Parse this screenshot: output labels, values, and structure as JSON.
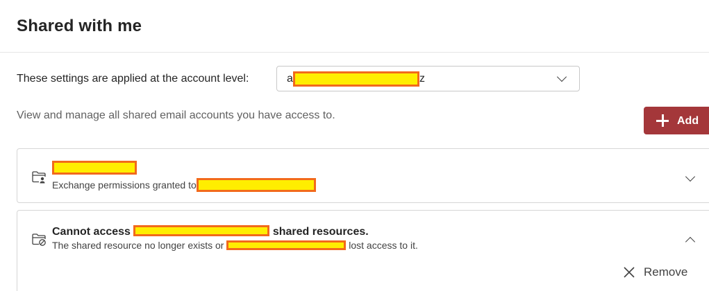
{
  "page": {
    "title": "Shared with me"
  },
  "account": {
    "label": "These settings are applied at the account level:",
    "selected_prefix": "a",
    "selected_suffix": "z"
  },
  "description": "View and manage all shared email accounts you have access to.",
  "add_button": {
    "label": "Add"
  },
  "shared_items": [
    {
      "title": "",
      "subtitle_prefix": "Exchange permissions granted to",
      "icon": "folder-person-icon",
      "expanded": false
    },
    {
      "title_prefix": "Cannot access",
      "title_suffix": "shared resources.",
      "subtitle_prefix": "The shared resource no longer exists or",
      "subtitle_suffix": "lost access to it.",
      "icon": "folder-blocked-icon",
      "expanded": true,
      "remove_label": "Remove"
    }
  ],
  "colors": {
    "accent": "#a4373a",
    "redaction_fill": "#ffee00",
    "redaction_border": "#f26a1b"
  }
}
